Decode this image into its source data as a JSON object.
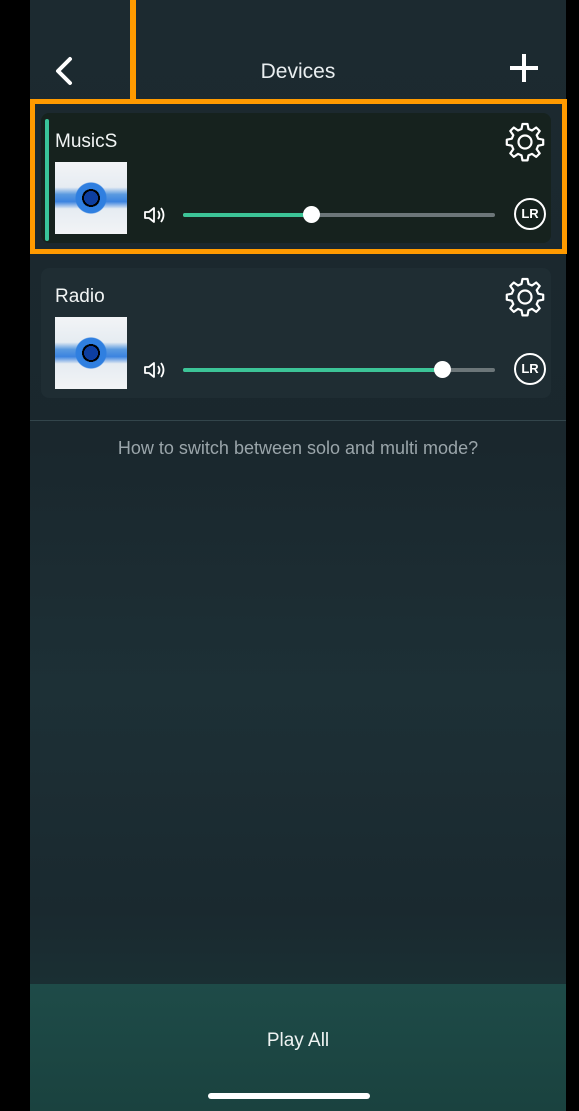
{
  "header": {
    "title": "Devices",
    "back_icon": "chevron-left-icon",
    "add_icon": "plus-icon"
  },
  "devices": [
    {
      "name": "MusicS",
      "volume": 0.41,
      "active": true,
      "channel_label": "LR"
    },
    {
      "name": "Radio",
      "volume": 0.83,
      "active": false,
      "channel_label": "LR"
    }
  ],
  "help_text": "How to switch between solo and multi mode?",
  "footer": {
    "play_all_label": "Play All"
  },
  "colors": {
    "accent": "#3cc497",
    "highlight_annotation": "#ff9a00"
  }
}
